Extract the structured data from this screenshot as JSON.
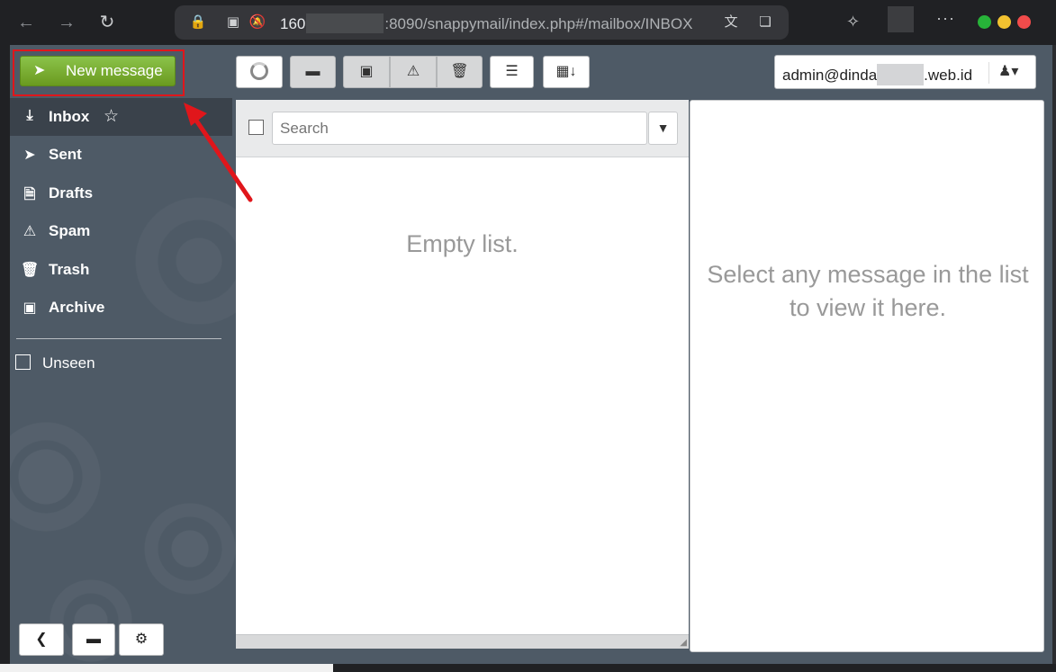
{
  "browser": {
    "url_prefix": "160",
    "url_rest": ":8090/snappymail/index.php#/mailbox/INBOX",
    "icons": [
      "back-icon",
      "forward-icon",
      "reload-icon",
      "lock-icon",
      "site-settings-icon",
      "notifications-off-icon",
      "translate-icon",
      "bookmarks-icon",
      "extensions-icon",
      "more-icon"
    ]
  },
  "compose": {
    "label": "New message"
  },
  "toolbar": {
    "buttons": [
      "refresh",
      "move-to-folder",
      "archive",
      "spam",
      "delete",
      "view-options",
      "sort-by-date"
    ]
  },
  "account": {
    "email_prefix": "admin@dinda",
    "email_suffix": ".web.id"
  },
  "sidebar": {
    "folders": [
      {
        "label": "Inbox",
        "icon": "inbox-icon"
      },
      {
        "label": "Sent",
        "icon": "paper-plane-icon"
      },
      {
        "label": "Drafts",
        "icon": "draft-file-icon"
      },
      {
        "label": "Spam",
        "icon": "warning-icon"
      },
      {
        "label": "Trash",
        "icon": "trash-icon"
      },
      {
        "label": "Archive",
        "icon": "archive-icon"
      }
    ],
    "unseen_label": "Unseen"
  },
  "list": {
    "search_placeholder": "Search",
    "empty_text": "Empty list."
  },
  "preview": {
    "empty_text": "Select any message in the list to view it here."
  },
  "colors": {
    "accent_green": "#7bad2a",
    "highlight_red": "#e0161b",
    "sidebar_bg": "#4e5a66"
  }
}
